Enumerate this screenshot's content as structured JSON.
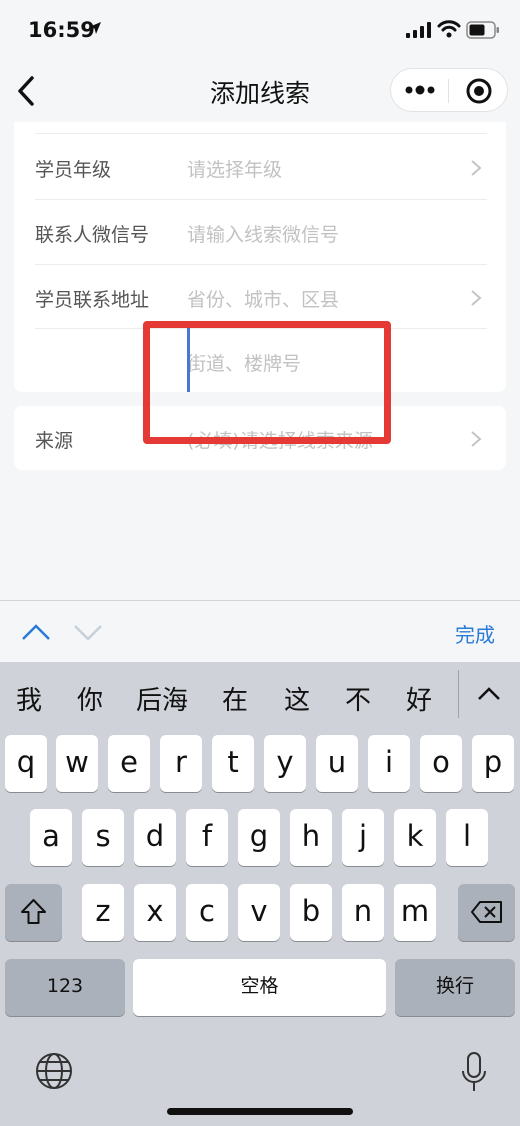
{
  "status_bar": {
    "time": "16:59"
  },
  "nav": {
    "title": "添加线索"
  },
  "form": {
    "rows": [
      {
        "label": "学员年级",
        "placeholder": "请选择年级"
      },
      {
        "label": "联系人微信号",
        "placeholder": "请输入线索微信号"
      },
      {
        "label": "学员联系地址",
        "placeholder": "省份、城市、区县"
      },
      {
        "label": "",
        "placeholder": "街道、楼牌号"
      }
    ],
    "source": {
      "label": "来源",
      "placeholder": "(必填)请选择线索来源"
    }
  },
  "accessory": {
    "done_label": "完成"
  },
  "keyboard": {
    "candidates": [
      "我",
      "你",
      "后海",
      "在",
      "这",
      "不",
      "好"
    ],
    "row1": [
      "q",
      "w",
      "e",
      "r",
      "t",
      "y",
      "u",
      "i",
      "o",
      "p"
    ],
    "row2": [
      "a",
      "s",
      "d",
      "f",
      "g",
      "h",
      "j",
      "k",
      "l"
    ],
    "row3": [
      "z",
      "x",
      "c",
      "v",
      "b",
      "n",
      "m"
    ],
    "numbers_label": "123",
    "space_label": "空格",
    "return_label": "换行"
  },
  "colors": {
    "accent": "#2a7bd8",
    "highlight": "#e53935",
    "caret": "#4a77d4"
  }
}
